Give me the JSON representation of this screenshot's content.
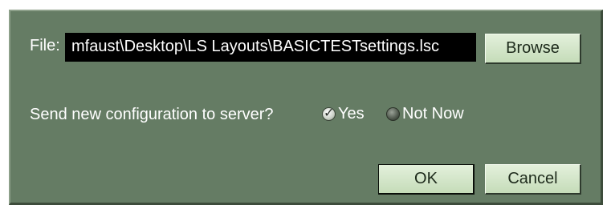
{
  "dialog": {
    "file_label": "File:",
    "file_path": "mfaust\\Desktop\\LS Layouts\\BASICTESTsettings.lsc",
    "browse_label": "Browse",
    "question": "Send new configuration to server?",
    "options": [
      {
        "label": "Yes",
        "selected": true
      },
      {
        "label": "Not Now",
        "selected": false
      }
    ],
    "ok_label": "OK",
    "cancel_label": "Cancel"
  },
  "colors": {
    "panel_background": "#657c64",
    "field_background": "#000000",
    "button_face": "#d4e8c9",
    "text": "#ffffff"
  },
  "icons": {
    "selected_radio": "checked-radio-icon",
    "unselected_radio": "radio-icon"
  }
}
